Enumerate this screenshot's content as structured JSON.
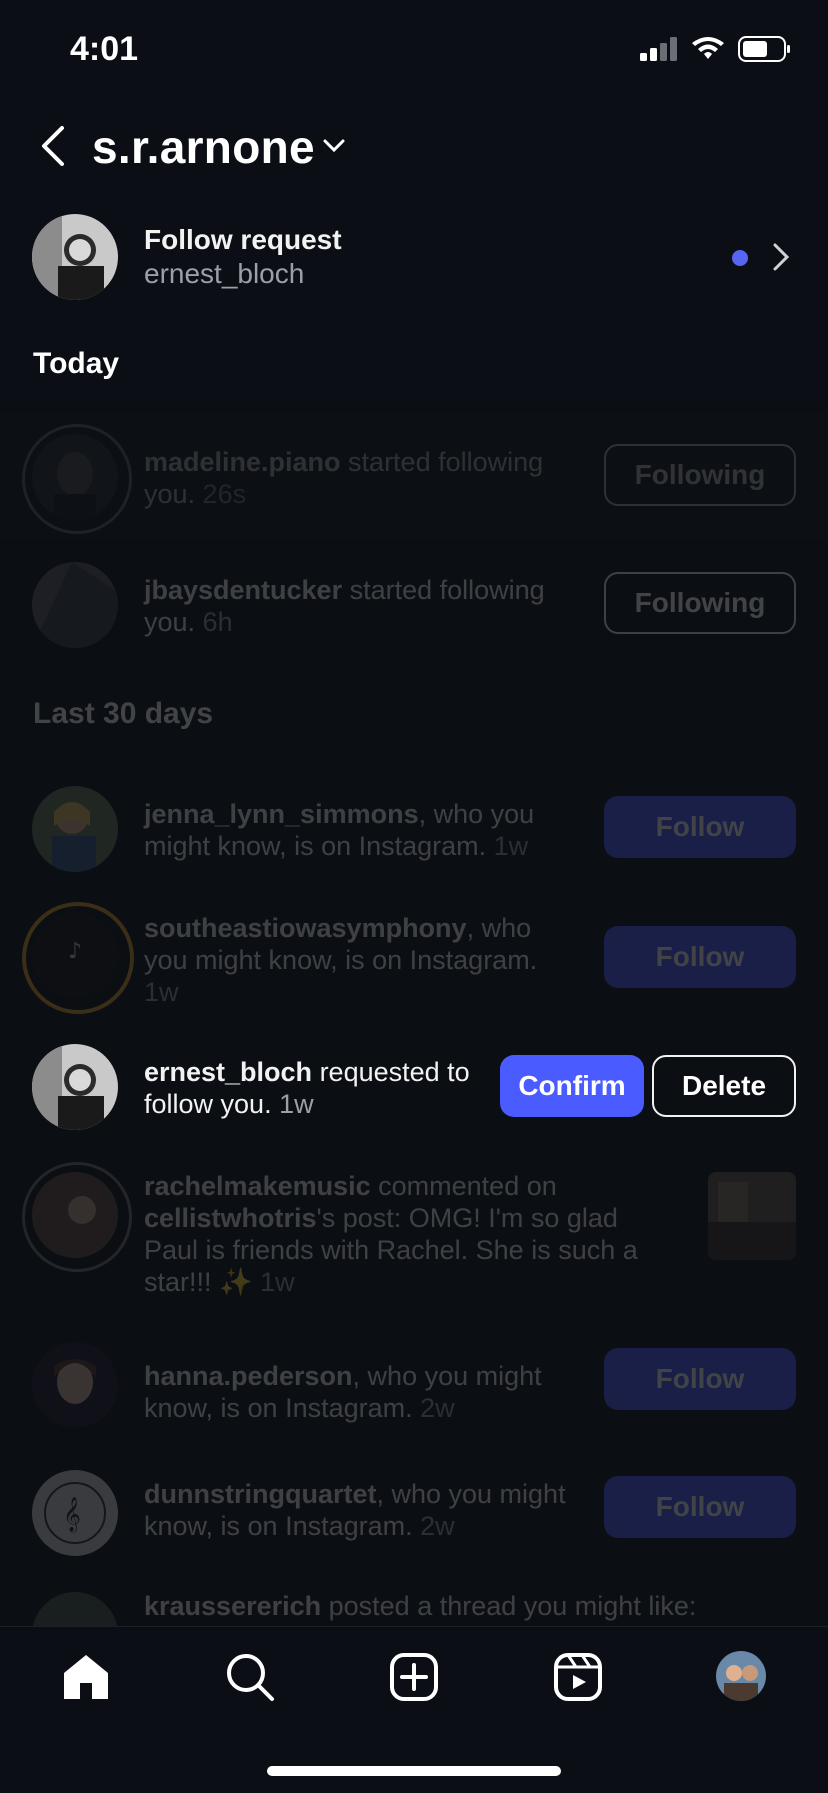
{
  "status_bar": {
    "time": "4:01"
  },
  "header": {
    "title": "s.r.arnone"
  },
  "follow_request": {
    "label": "Follow request",
    "username": "ernest_bloch"
  },
  "sections": {
    "today": "Today",
    "last30": "Last 30 days"
  },
  "notifications": [
    {
      "username": "madeline.piano",
      "text": " started following you.",
      "time": " 26s",
      "button": "Following"
    },
    {
      "username": "jbaysdentucker",
      "text": " started following you.",
      "time": " 6h",
      "button": "Following"
    },
    {
      "username": "jenna_lynn_simmons",
      "text": ", who you might know, is on Instagram.",
      "time": " 1w",
      "button": "Follow"
    },
    {
      "username": "southeastiowasymphony",
      "text": ", who you might know, is on Instagram.",
      "time": " 1w",
      "button": "Follow"
    },
    {
      "username": "ernest_bloch",
      "text": " requested to follow you.",
      "time": " 1w",
      "confirm": "Confirm",
      "delete": "Delete"
    },
    {
      "username": "rachelmakemusic",
      "text": " commented on ",
      "mention": "cellistwhotris",
      "text2": "'s post: OMG! I'm so glad Paul is friends with Rachel. She is such a star!!! ✨",
      "time": " 1w"
    },
    {
      "username": "hanna.pederson",
      "text": ", who you might know, is on Instagram.",
      "time": " 2w",
      "button": "Follow"
    },
    {
      "username": "dunnstringquartet",
      "text": ", who you might know, is on Instagram.",
      "time": " 2w",
      "button": "Follow"
    },
    {
      "username": "kraussererich",
      "text": " posted a thread you might like:"
    }
  ],
  "colors": {
    "background": "#0b0f15",
    "accent": "#4a5cff",
    "unread_dot": "#5865f2"
  },
  "tabbar": [
    "home-icon",
    "search-icon",
    "create-icon",
    "reels-icon",
    "profile-avatar"
  ]
}
